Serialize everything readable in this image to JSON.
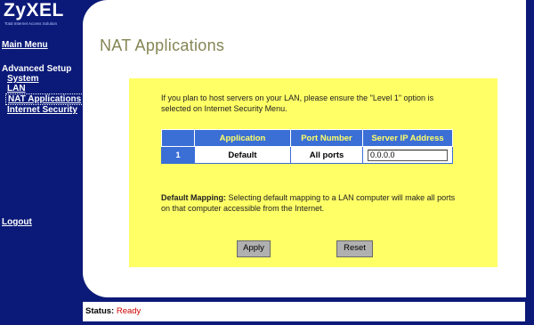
{
  "brand": {
    "logo": "ZyXEL",
    "tagline": "Total Internet Access Solution"
  },
  "sidebar": {
    "main_menu": "Main Menu",
    "advanced_setup": "Advanced Setup",
    "items": [
      {
        "label": "System"
      },
      {
        "label": "LAN"
      },
      {
        "label": "NAT Applications"
      },
      {
        "label": "Internet Security"
      }
    ],
    "logout": "Logout"
  },
  "page": {
    "title": "NAT Applications",
    "intro": "If you plan to host servers on your LAN, please ensure the \"Level 1\" option is selected on Internet Security Menu.",
    "table": {
      "headers": [
        "",
        "Application",
        "Port Number",
        "Server IP Address"
      ],
      "rows": [
        {
          "index": "1",
          "application": "Default",
          "port": "All ports",
          "server_ip": "0.0.0.0"
        }
      ]
    },
    "mapping_label": "Default Mapping:",
    "mapping_text": "Selecting default mapping to a LAN computer will make all ports on that computer accessible from the Internet.",
    "apply_label": "Apply",
    "reset_label": "Reset"
  },
  "status": {
    "label": "Status:",
    "value": "Ready"
  },
  "colors": {
    "nav_background": "#0b1a78",
    "panel_background": "#ffff66",
    "table_header": "#3b6fd6",
    "header_text": "#ffff66",
    "status_value": "#cc0000"
  }
}
